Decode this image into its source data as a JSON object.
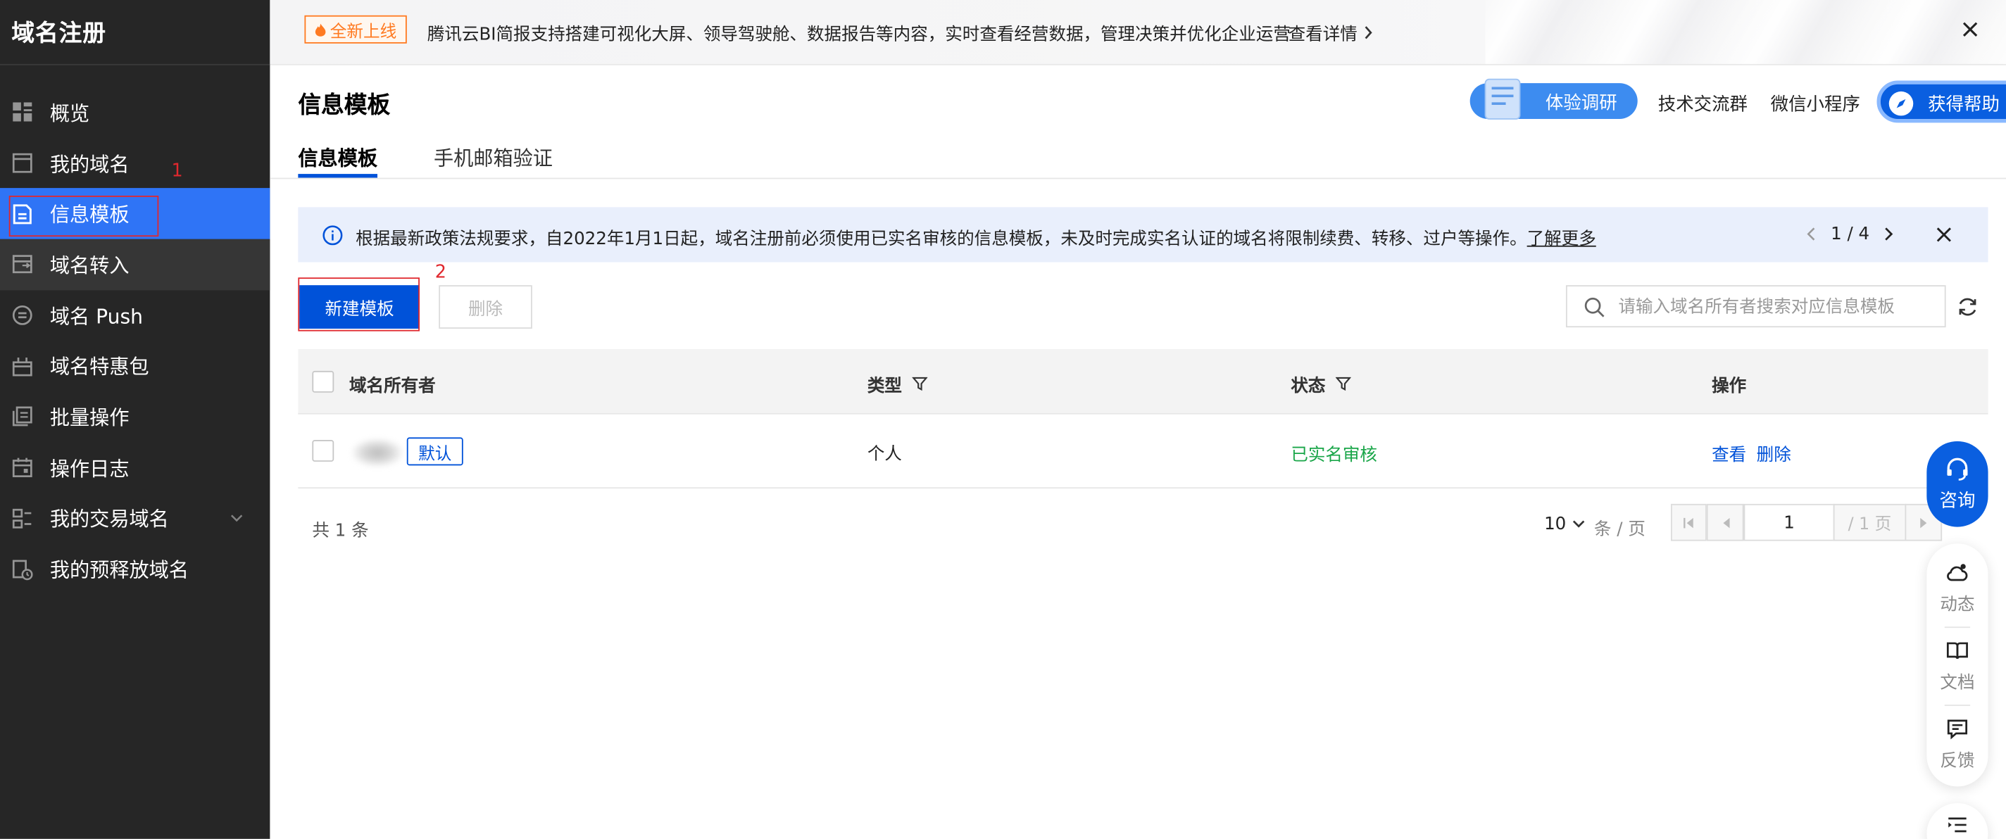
{
  "sidebar": {
    "title": "域名注册",
    "items": [
      {
        "label": "概览"
      },
      {
        "label": "我的域名"
      },
      {
        "label": "信息模板"
      },
      {
        "label": "域名转入"
      },
      {
        "label": "域名 Push"
      },
      {
        "label": "域名特惠包"
      },
      {
        "label": "批量操作"
      },
      {
        "label": "操作日志"
      },
      {
        "label": "我的交易域名"
      },
      {
        "label": "我的预释放域名"
      }
    ]
  },
  "notice": {
    "tag": "全新上线",
    "text": "腾讯云BI简报支持搭建可视化大屏、领导驾驶舱、数据报告等内容，实时查看经营数据，管理决策并优化企业运营",
    "link": "查看详情"
  },
  "header": {
    "title": "信息模板",
    "survey": "体验调研",
    "tech_group": "技术交流群",
    "mini_program": "微信小程序",
    "help": "获得帮助"
  },
  "tabs": [
    {
      "label": "信息模板"
    },
    {
      "label": "手机邮箱验证"
    }
  ],
  "alert": {
    "text": "根据最新政策法规要求，自2022年1月1日起，域名注册前必须使用已实名审核的信息模板，未及时完成实名认证的域名将限制续费、转移、过户等操作。",
    "more": "了解更多",
    "pager": "1 / 4"
  },
  "actions": {
    "new_button": "新建模板",
    "delete_button": "删除",
    "search_placeholder": "请输入域名所有者搜索对应信息模板"
  },
  "annotations": {
    "marker_1": "1",
    "marker_2": "2"
  },
  "table": {
    "columns": {
      "owner": "域名所有者",
      "type": "类型",
      "status": "状态",
      "actions": "操作"
    },
    "rows": [
      {
        "owner_tag": "默认",
        "type": "个人",
        "status": "已实名审核",
        "view": "查看",
        "delete": "删除"
      }
    ],
    "footer": {
      "total": "共 1 条",
      "page_size": "10",
      "page_unit": "条 / 页",
      "current_page": "1",
      "total_pages": "/ 1 页"
    }
  },
  "float": {
    "consult": "咨询",
    "news": "动态",
    "docs": "文档",
    "feedback": "反馈"
  },
  "colors": {
    "sidebar_bg": "#262626",
    "active": "#2f74f6",
    "brand": "#0052d9",
    "success": "#1aa649",
    "annotation": "#e0282e",
    "notice_tag": "#ff7a21"
  }
}
